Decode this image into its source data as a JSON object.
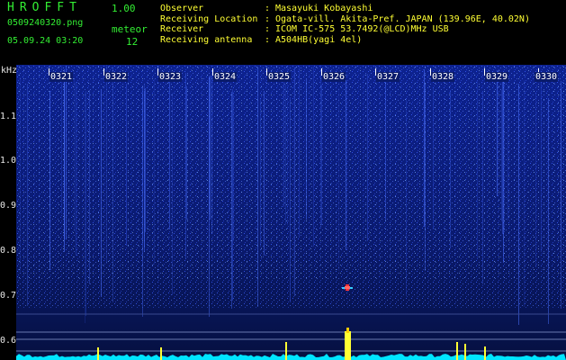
{
  "app": {
    "name": "HROFFT",
    "version": "1.00",
    "file_name": "0509240320.png",
    "datetime": "05.09.24 03:20"
  },
  "meteor": {
    "label": "meteor",
    "count": "12"
  },
  "observation": [
    {
      "key": "Observer",
      "sep": ":",
      "value": "Masayuki Kobayashi"
    },
    {
      "key": "Receiving Location",
      "sep": ":",
      "value": "Ogata-vill. Akita-Pref. JAPAN (139.96E, 40.02N)"
    },
    {
      "key": "Receiver",
      "sep": ":",
      "value": "ICOM IC-575 53.7492(@LCD)MHz USB"
    },
    {
      "key": "Receiving antenna",
      "sep": ":",
      "value": "A504HB(yagi 4el)"
    }
  ],
  "axis": {
    "unit": "kHz",
    "freq_labels": [
      "1.1",
      "1.0",
      "0.9",
      "0.8",
      "0.7",
      "0.6"
    ],
    "time_labels": [
      "0321",
      "0322",
      "0323",
      "0324",
      "0325",
      "0326",
      "0327",
      "0328",
      "0329",
      "0330"
    ]
  },
  "colors": {
    "header_green": "#33ee33",
    "header_yellow": "#ffff33",
    "spectrum_bg": "#0a1b6b",
    "spectrum_line": "#00e5ff",
    "echo": "#ff3333",
    "peak": "#ffff33"
  }
}
